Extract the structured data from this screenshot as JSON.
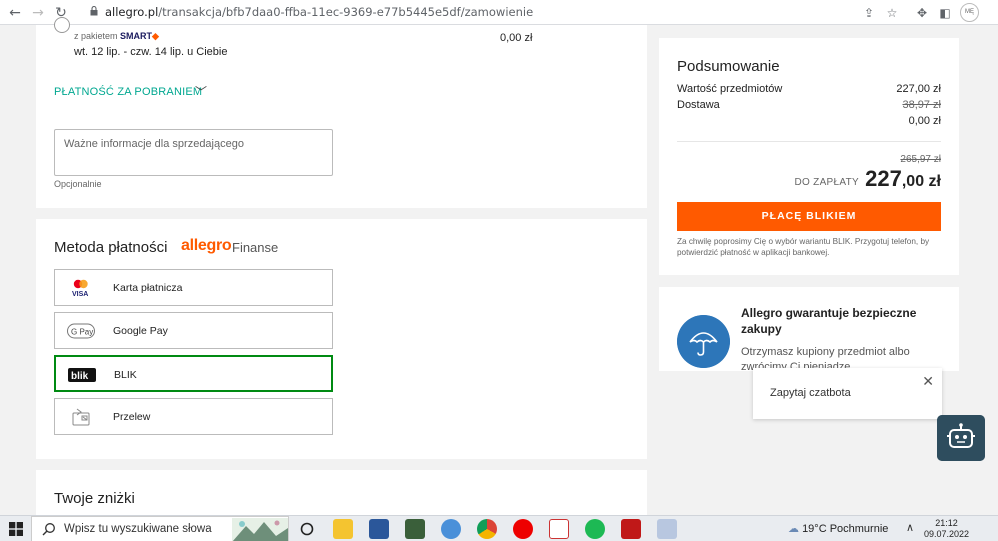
{
  "browser": {
    "url_host": "allegro.pl",
    "url_path": "/transakcja/bfb7daa0-ffba-11ec-9369-e77b5445e5df/zamowienie",
    "profile_text": "MĘ"
  },
  "delivery": {
    "package_prefix": "z pakietem",
    "package_name": "SMART",
    "dates": "wt. 12 lip. - czw. 14 lip. u Ciebie",
    "price": "0,00 zł",
    "cod_link": "PŁATNOŚĆ ZA POBRANIEM",
    "note_placeholder": "Ważne informacje dla sprzedającego",
    "note_hint": "Opcjonalnie"
  },
  "payment": {
    "heading": "Metoda płatności",
    "brand": "allegro",
    "brand_suffix": "Finanse",
    "options": [
      {
        "label": "Karta płatnicza",
        "icon": "card-icon",
        "selected": false
      },
      {
        "label": "Google Pay",
        "icon": "google-pay-icon",
        "selected": false
      },
      {
        "label": "BLIK",
        "icon": "blik-icon",
        "selected": true
      },
      {
        "label": "Przelew",
        "icon": "transfer-icon",
        "selected": false
      }
    ]
  },
  "discounts": {
    "heading": "Twoje zniżki"
  },
  "summary": {
    "title": "Podsumowanie",
    "items_label": "Wartość przedmiotów",
    "items_value": "227,00 zł",
    "delivery_label": "Dostawa",
    "delivery_old": "38,97 zł",
    "delivery_value": "0,00 zł",
    "total_old": "265,97 zł",
    "total_label": "DO ZAPŁATY",
    "total_main": "227",
    "total_decimals": ",00 zł",
    "pay_button": "PŁACĘ BLIKIEM",
    "pay_note": "Za chwilę poprosimy Cię o wybór wariantu BLIK. Przygotuj telefon, by potwierdzić płatność w aplikacji bankowej.",
    "accent_color": "#ff5a00"
  },
  "guarantee": {
    "title": "Allegro gwarantuje bezpieczne zakupy",
    "text": "Otrzymasz kupiony przedmiot albo zwrócimy Ci pieniądze."
  },
  "chat": {
    "label": "Zapytaj czatbota"
  },
  "taskbar": {
    "search_placeholder": "Wpisz tu wyszukiwane słowa",
    "weather": "19°C  Pochmurnie",
    "time": "21:12",
    "date": "09.07.2022"
  }
}
